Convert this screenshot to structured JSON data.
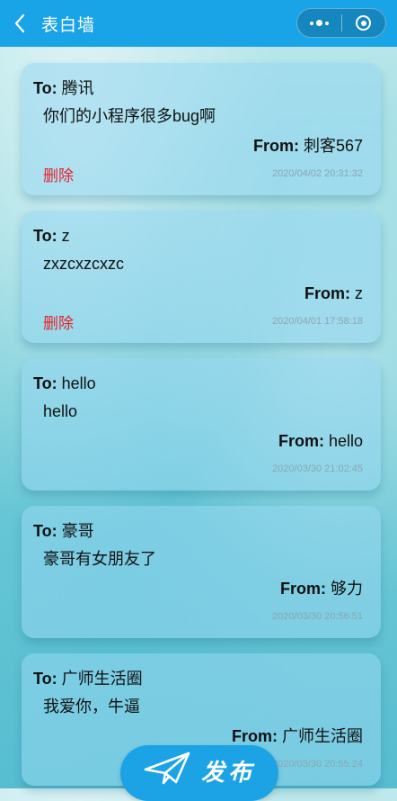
{
  "navbar": {
    "title": "表白墙",
    "back_icon": "chevron-left-icon",
    "more_icon": "more-dots-icon",
    "close_icon": "target-circle-icon"
  },
  "posts": [
    {
      "to_label": "To:",
      "to": " 腾讯",
      "message": "你们的小程序很多bug啊",
      "from_label": "From:",
      "from": " 刺客567",
      "delete_label": "删除",
      "time": "2020/04/02 20:31:32"
    },
    {
      "to_label": "To:",
      "to": " z",
      "message": "zxzcxzcxzc",
      "from_label": "From:",
      "from": " z",
      "delete_label": "删除",
      "time": "2020/04/01 17:58:18"
    },
    {
      "to_label": "To:",
      "to": " hello",
      "message": "hello",
      "from_label": "From:",
      "from": " hello",
      "time": "2020/03/30 21:02:45"
    },
    {
      "to_label": "To:",
      "to": " 豪哥",
      "message": "豪哥有女朋友了",
      "from_label": "From:",
      "from": " 够力",
      "time": "2020/03/30 20:56:51"
    },
    {
      "to_label": "To:",
      "to": " 广师生活圈",
      "message": "我爱你，牛逼",
      "from_label": "From:",
      "from": " 广师生活圈",
      "time": "2020/03/30 20:55:24"
    }
  ],
  "publish": {
    "label": "发布",
    "icon": "paper-plane-icon"
  },
  "colors": {
    "navbar": "#1aa4e8",
    "delete": "#e2232a",
    "publish": "#1ba3e6"
  }
}
